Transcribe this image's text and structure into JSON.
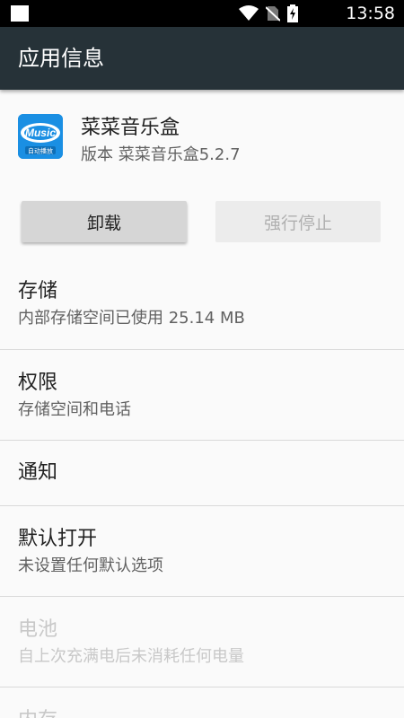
{
  "status_bar": {
    "time": "13:58",
    "icons": [
      "notification-square-icon",
      "wifi-icon",
      "no-sim-icon",
      "battery-charging-icon"
    ]
  },
  "app_bar": {
    "title": "应用信息"
  },
  "app": {
    "icon_text": "Music",
    "icon_subtext": "自动播放",
    "name": "菜菜音乐盒",
    "version": "版本 菜菜音乐盒5.2.7"
  },
  "buttons": {
    "uninstall": "卸载",
    "force_stop": "强行停止"
  },
  "items": [
    {
      "title": "存储",
      "subtitle": "内部存储空间已使用 25.14 MB",
      "enabled": true
    },
    {
      "title": "权限",
      "subtitle": "存储空间和电话",
      "enabled": true
    },
    {
      "title": "通知",
      "subtitle": "",
      "enabled": true
    },
    {
      "title": "默认打开",
      "subtitle": "未设置任何默认选项",
      "enabled": true
    },
    {
      "title": "电池",
      "subtitle": "自上次充满电后未消耗任何电量",
      "enabled": false
    },
    {
      "title": "内存",
      "subtitle": "",
      "enabled": false
    }
  ],
  "colors": {
    "status_bar": "#000000",
    "app_bar": "#263238",
    "background": "#fafafa",
    "icon_blue": "#1a8fe3"
  }
}
